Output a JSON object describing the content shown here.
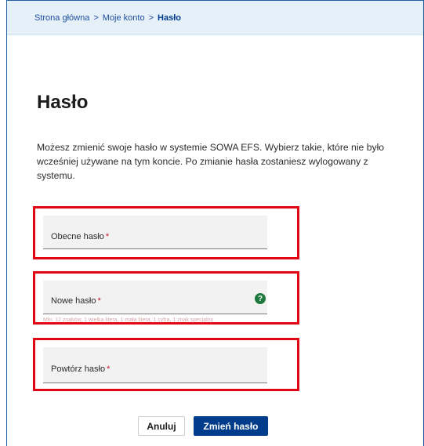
{
  "breadcrumb": {
    "items": [
      "Strona główna",
      "Moje konto",
      "Hasło"
    ],
    "separator": ">"
  },
  "page": {
    "title": "Hasło",
    "intro": "Możesz zmienić swoje hasło w systemie SOWA EFS. Wybierz takie, które nie było wcześniej używane na tym koncie. Po zmianie hasła zostaniesz wylogowany z systemu."
  },
  "form": {
    "required_mark": "*",
    "current_password": {
      "label": "Obecne hasło",
      "value": ""
    },
    "new_password": {
      "label": "Nowe hasło",
      "value": "",
      "help_icon": "?",
      "hint": "Min. 12 znaków, 1 wielka litera, 1 mała litera, 1 cyfra, 1 znak specjalny"
    },
    "repeat_password": {
      "label": "Powtórz hasło",
      "value": ""
    }
  },
  "buttons": {
    "cancel": "Anuluj",
    "submit": "Zmień hasło"
  },
  "colors": {
    "brand": "#003c8c",
    "highlight": "#e30613",
    "help": "#1e7a3c",
    "breadcrumb_bg": "#e6f0f8"
  }
}
